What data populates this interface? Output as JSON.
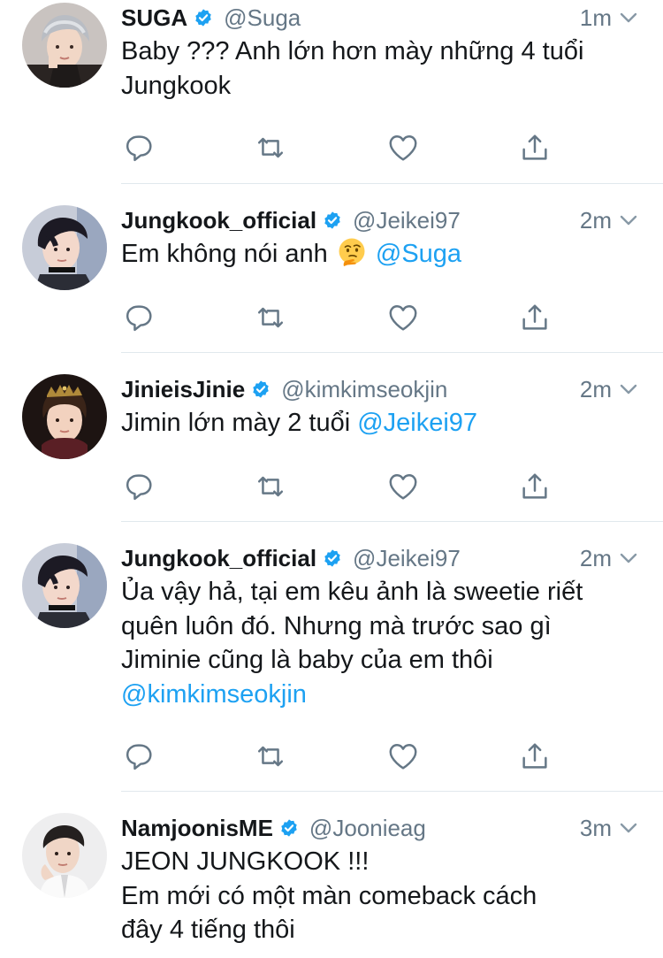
{
  "colors": {
    "link": "#1da1f2",
    "secondary_text": "#657786",
    "primary_text": "#14171a",
    "divider": "#e1e8ed",
    "verified_badge": "#1da1f2"
  },
  "icons": {
    "reply": "reply-icon",
    "retweet": "retweet-icon",
    "like": "heart-icon",
    "share": "share-icon",
    "verified": "verified-badge-icon",
    "caret": "chevron-down-icon",
    "emoji": "thinking-face-emoji"
  },
  "tweets": [
    {
      "name": "SUGA",
      "handle": "@Suga",
      "time": "1m",
      "lines": [
        [
          {
            "text": "Baby ??? Anh lớn hơn mày những 4 tuổi"
          }
        ],
        [
          {
            "text": "Jungkook"
          }
        ]
      ]
    },
    {
      "name": "Jungkook_official",
      "handle": "@Jeikei97",
      "time": "2m",
      "lines": [
        [
          {
            "text": "Em không nói anh "
          },
          {
            "emoji": "thinking-face"
          },
          {
            "text": " "
          },
          {
            "mention": "@Suga"
          }
        ]
      ]
    },
    {
      "name": "JinieisJinie",
      "handle": "@kimkimseokjin",
      "time": "2m",
      "lines": [
        [
          {
            "text": "Jimin lớn mày 2 tuổi "
          },
          {
            "mention": "@Jeikei97"
          }
        ]
      ]
    },
    {
      "name": "Jungkook_official",
      "handle": "@Jeikei97",
      "time": "2m",
      "lines": [
        [
          {
            "text": "Ủa vậy hả, tại em kêu ảnh là sweetie riết"
          }
        ],
        [
          {
            "text": "quên luôn đó. Nhưng mà trước sao gì"
          }
        ],
        [
          {
            "text": "Jiminie cũng là baby của em thôi"
          }
        ],
        [
          {
            "mention": "@kimkimseokjin"
          }
        ]
      ]
    },
    {
      "name": "NamjoonisME",
      "handle": "@Joonieag",
      "time": "3m",
      "lines": [
        [
          {
            "text": "JEON JUNGKOOK !!!"
          }
        ],
        [
          {
            "text": "Em mới có một màn comeback cách"
          }
        ],
        [
          {
            "text": "đây 4 tiếng thôi"
          }
        ]
      ]
    }
  ]
}
